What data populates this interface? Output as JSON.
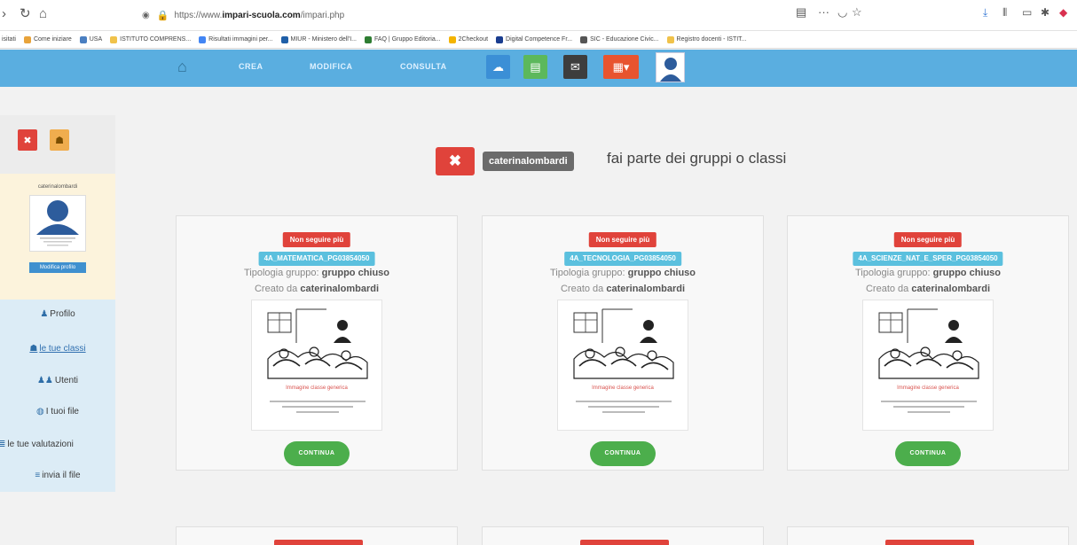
{
  "browser": {
    "url_prefix": "https://www.",
    "url_host": "impari-scuola.com",
    "url_path": "/impari.php",
    "bookmarks": [
      {
        "label": "Come iniziare",
        "color": "#e8a33a"
      },
      {
        "label": "USA",
        "color": "#4a7fc1"
      },
      {
        "label": "ISTITUTO COMPRENS...",
        "color": "#f0c24a"
      },
      {
        "label": "Risultati immagini per...",
        "color": "#4285f4"
      },
      {
        "label": "MIUR - Ministero dell'I...",
        "color": "#1f5fa8"
      },
      {
        "label": "FAQ | Gruppo Editoria...",
        "color": "#2e7d32"
      },
      {
        "label": "2Checkout",
        "color": "#f4b400"
      },
      {
        "label": "Digital Competence Fr...",
        "color": "#1a3d8f"
      },
      {
        "label": "SIC - Educazione Civic...",
        "color": "#555555"
      },
      {
        "label": "Registro docenti - ISTIT...",
        "color": "#f0c24a"
      }
    ]
  },
  "nav": {
    "items": [
      "CREA",
      "MODIFICA",
      "CONSULTA"
    ],
    "colors": {
      "bar": "#5aaee0",
      "blue": "#3b8fd6",
      "green": "#5cb85c",
      "dark": "#3d3d3d",
      "orange": "#e8542f"
    }
  },
  "profile": {
    "name": "caterinalombardi",
    "edit_label": "Modifica profilo"
  },
  "menu": [
    {
      "label": "Profilo",
      "icon": "user-icon",
      "glyph": "♟"
    },
    {
      "label": "le tue classi",
      "icon": "group-icon",
      "glyph": "☗"
    },
    {
      "label": "Utenti",
      "icon": "users-icon",
      "glyph": "♟♟"
    },
    {
      "label": "I tuoi file",
      "icon": "globe-icon",
      "glyph": "◍"
    },
    {
      "label": "le tue valutazioni",
      "icon": "list-icon",
      "glyph": "≣"
    },
    {
      "label": "invia il file",
      "icon": "file-icon",
      "glyph": "≡"
    }
  ],
  "header": {
    "close_glyph": "✖",
    "username": "caterinalombardi",
    "text": "fai parte dei gruppi o classi"
  },
  "cards": [
    {
      "unfollow": "Non seguire più",
      "group": "4A_MATEMATICA_PG03854050",
      "type_label": "Tipologia gruppo:",
      "type_value": "gruppo chiuso",
      "creator_label": "Creato da",
      "creator": "caterinalombardi",
      "image_caption": "Immagine classe generica",
      "button": "CONTINUA"
    },
    {
      "unfollow": "Non seguire più",
      "group": "4A_TECNOLOGIA_PG03854050",
      "type_label": "Tipologia gruppo:",
      "type_value": "gruppo chiuso",
      "creator_label": "Creato da",
      "creator": "caterinalombardi",
      "image_caption": "Immagine classe generica",
      "button": "CONTINUA"
    },
    {
      "unfollow": "Non seguire più",
      "group": "4A_SCIENZE_NAT_E_SPER_PG03854050",
      "type_label": "Tipologia gruppo:",
      "type_value": "gruppo chiuso",
      "creator_label": "Creato da",
      "creator": "caterinalombardi",
      "image_caption": "Immagine classe generica",
      "button": "CONTINUA"
    }
  ]
}
